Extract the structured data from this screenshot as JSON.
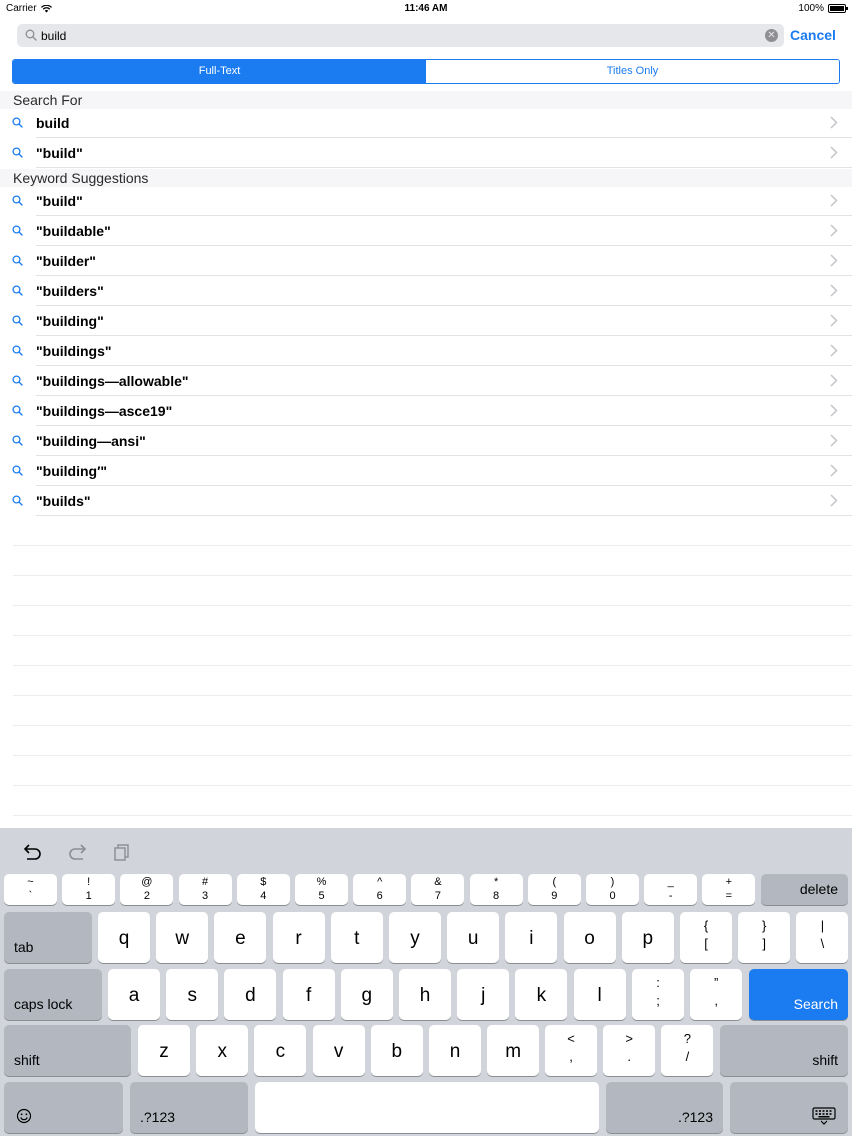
{
  "status_bar": {
    "carrier": "Carrier",
    "time": "11:46 AM",
    "battery": "100%"
  },
  "search": {
    "query": "build",
    "cancel_label": "Cancel",
    "clear_icon": "clear-icon",
    "search_icon": "search-icon"
  },
  "segments": [
    {
      "label": "Full-Text",
      "selected": true
    },
    {
      "label": "Titles Only",
      "selected": false
    }
  ],
  "search_for": {
    "header": "Search For",
    "items": [
      {
        "label": "build"
      },
      {
        "label": "\"build\""
      }
    ]
  },
  "keyword_suggestions": {
    "header": "Keyword Suggestions",
    "items": [
      {
        "label": "\"build\""
      },
      {
        "label": "\"buildable\""
      },
      {
        "label": "\"builder\""
      },
      {
        "label": "\"builders\""
      },
      {
        "label": "\"building\""
      },
      {
        "label": "\"buildings\""
      },
      {
        "label": "\"buildings—allowable\""
      },
      {
        "label": "\"buildings—asce19\""
      },
      {
        "label": "\"building—ansi\""
      },
      {
        "label": "\"building′\""
      },
      {
        "label": "\"builds\""
      }
    ]
  },
  "keyboard": {
    "shortcut_icons": [
      "undo-icon",
      "redo-icon",
      "paste-icon"
    ],
    "number_row": [
      {
        "top": "~",
        "bot": "`"
      },
      {
        "top": "!",
        "bot": "1"
      },
      {
        "top": "@",
        "bot": "2"
      },
      {
        "top": "#",
        "bot": "3"
      },
      {
        "top": "$",
        "bot": "4"
      },
      {
        "top": "%",
        "bot": "5"
      },
      {
        "top": "^",
        "bot": "6"
      },
      {
        "top": "&",
        "bot": "7"
      },
      {
        "top": "*",
        "bot": "8"
      },
      {
        "top": "(",
        "bot": "9"
      },
      {
        "top": ")",
        "bot": "0"
      },
      {
        "top": "_",
        "bot": "-"
      },
      {
        "top": "+",
        "bot": "="
      }
    ],
    "delete_label": "delete",
    "tab_label": "tab",
    "row_q": [
      "q",
      "w",
      "e",
      "r",
      "t",
      "y",
      "u",
      "i",
      "o",
      "p"
    ],
    "row_q_symbols": [
      {
        "top": "{",
        "bot": "["
      },
      {
        "top": "}",
        "bot": "]"
      },
      {
        "top": "|",
        "bot": "\\"
      }
    ],
    "caps_label": "caps lock",
    "row_a": [
      "a",
      "s",
      "d",
      "f",
      "g",
      "h",
      "j",
      "k",
      "l"
    ],
    "row_a_symbols": [
      {
        "top": ":",
        "bot": ";"
      },
      {
        "top": "”",
        "bot": ","
      }
    ],
    "search_label": "Search",
    "shift_label": "shift",
    "row_z": [
      "z",
      "x",
      "c",
      "v",
      "b",
      "n",
      "m"
    ],
    "row_z_symbols": [
      {
        "top": "<",
        "bot": ","
      },
      {
        "top": ">",
        "bot": "."
      },
      {
        "top": "?",
        "bot": "/"
      }
    ],
    "numbers_label": ".?123",
    "emoji_icon": "emoji-icon",
    "dismiss_icon": "keyboard-dismiss-icon"
  }
}
